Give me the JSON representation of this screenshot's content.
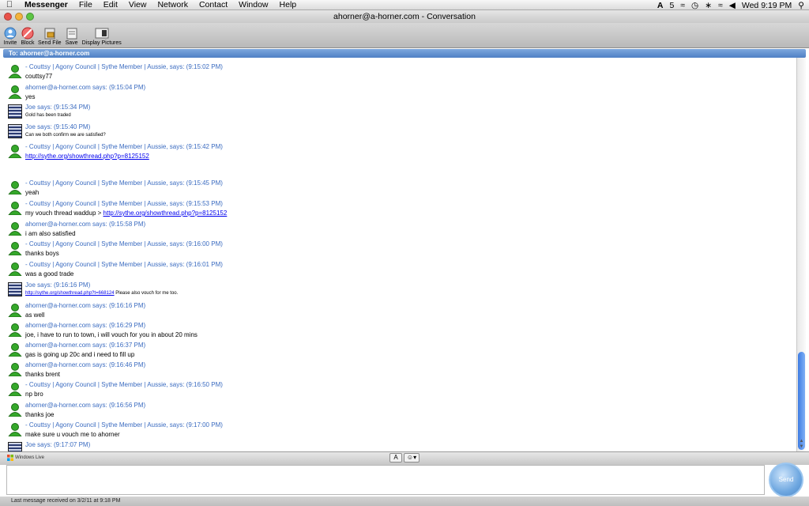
{
  "menubar": {
    "apple": "",
    "app": "Messenger",
    "items": [
      "File",
      "Edit",
      "View",
      "Network",
      "Contact",
      "Window",
      "Help"
    ],
    "status_text": "Wed 9:19 PM",
    "battery": "5"
  },
  "window": {
    "title": "ahorner@a-horner.com - Conversation"
  },
  "toolbar": {
    "invite": "Invite",
    "block": "Block",
    "send_file": "Send File",
    "save": "Save",
    "display_pictures": "Display Pictures"
  },
  "to_bar": "To: ahorner@a-horner.com",
  "messages": [
    {
      "who": "coutt",
      "header": "- Couttsy | Agony Council | Sythe Member | Aussie, says: (9:15:02 PM)",
      "body": "couttsy77"
    },
    {
      "who": "ahorner",
      "header": "ahorner@a-horner.com says: (9:15:04 PM)",
      "body": "yes"
    },
    {
      "who": "joe",
      "header": "Joe says: (9:15:34 PM)",
      "body": "Gold has been traded"
    },
    {
      "who": "joe",
      "header": "Joe says: (9:15:40 PM)",
      "body": "Can we both confirm we are satisfied?"
    },
    {
      "who": "coutt",
      "header": "- Couttsy | Agony Council | Sythe Member | Aussie, says: (9:15:42 PM)",
      "link": "http://sythe.org/showthread.php?p=8125152"
    },
    {
      "who": "coutt",
      "header": "- Couttsy | Agony Council | Sythe Member | Aussie, says: (9:15:45 PM)",
      "body": "yeah"
    },
    {
      "who": "coutt",
      "header": "- Couttsy | Agony Council | Sythe Member | Aussie, says: (9:15:53 PM)",
      "body": "my vouch thread waddup > ",
      "link": "http://sythe.org/showthread.php?p=8125152"
    },
    {
      "who": "ahorner",
      "header": "ahorner@a-horner.com says: (9:15:58 PM)",
      "body": "i am also satisfied"
    },
    {
      "who": "coutt",
      "header": "- Couttsy | Agony Council | Sythe Member | Aussie, says: (9:16:00 PM)",
      "body": "thanks boys"
    },
    {
      "who": "coutt",
      "header": "- Couttsy | Agony Council | Sythe Member | Aussie, says: (9:16:01 PM)",
      "body": "was a good trade"
    },
    {
      "who": "joe",
      "header": "Joe says: (9:16:16 PM)",
      "link": "http://sythe.org/showthread.php?t=668124",
      "body_after": " Please also vouch for me too."
    },
    {
      "who": "ahorner",
      "header": "ahorner@a-horner.com says: (9:16:16 PM)",
      "body": "as well"
    },
    {
      "who": "ahorner",
      "header": "ahorner@a-horner.com says: (9:16:29 PM)",
      "body": "joe, i have to run to town, i will vouch for you in about 20 mins"
    },
    {
      "who": "ahorner",
      "header": "ahorner@a-horner.com says: (9:16:37 PM)",
      "body": "gas is going up 20c and i need to fill up"
    },
    {
      "who": "ahorner",
      "header": "ahorner@a-horner.com says: (9:16:46 PM)",
      "body": "thanks brent"
    },
    {
      "who": "coutt",
      "header": "- Couttsy | Agony Council | Sythe Member | Aussie, says: (9:16:50 PM)",
      "body": "np bro"
    },
    {
      "who": "ahorner",
      "header": "ahorner@a-horner.com says: (9:16:56 PM)",
      "body": "thanks joe"
    },
    {
      "who": "coutt",
      "header": "- Couttsy | Agony Council | Sythe Member | Aussie, says: (9:17:00 PM)",
      "body": "make sure u vouch me to ahorner"
    },
    {
      "who": "joe",
      "header": "Joe says: (9:17:07 PM)",
      "body": ""
    }
  ],
  "windows_live": "Windows Live",
  "format": {
    "font": "A",
    "emoticon": "☺▾"
  },
  "send_label": "Send",
  "status_bar": "Last message received on 3/2/11 at 9:18 PM"
}
